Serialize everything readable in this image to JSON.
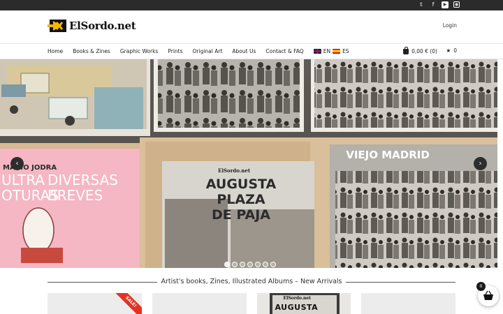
{
  "topbar": {
    "social": [
      {
        "icon": "twitter-icon",
        "glyph": "𝕥"
      },
      {
        "icon": "facebook-icon",
        "glyph": "f"
      },
      {
        "icon": "youtube-icon",
        "glyph": "▶"
      },
      {
        "icon": "instagram-icon",
        "glyph": "◉"
      }
    ]
  },
  "header": {
    "logo_text": "ElSordo.net",
    "login_label": "Login"
  },
  "nav": {
    "items": [
      "Home",
      "Books & Zines",
      "Graphic Works",
      "Prints",
      "Original Art",
      "About Us",
      "Contact & FAQ"
    ],
    "lang_en": "EN",
    "lang_es": "ES",
    "cart_label": "0,00 € (0)",
    "wishlist_count": "0"
  },
  "slider": {
    "dot_count": 7,
    "active_dot": 0,
    "book_titles": [
      "AUGUSTA",
      "PLAZA",
      "DE PAJA",
      "VIEJO MADRID",
      "ULTRA",
      "DIVERSAS",
      "OTURAS",
      "BREVES",
      "MARIO JODRA"
    ]
  },
  "section": {
    "title": "Artist's books, Zines, Illustrated Albums – New Arrivals"
  },
  "products": {
    "sale_label": "SALE!",
    "mini_logo": "ElSordo.net",
    "mini_title": "AUGUSTA"
  },
  "cart_fab": {
    "count": "0"
  },
  "colors": {
    "topbar": "#2b2b2b",
    "sale": "#e53222",
    "arrow": "#2d2d2d"
  }
}
